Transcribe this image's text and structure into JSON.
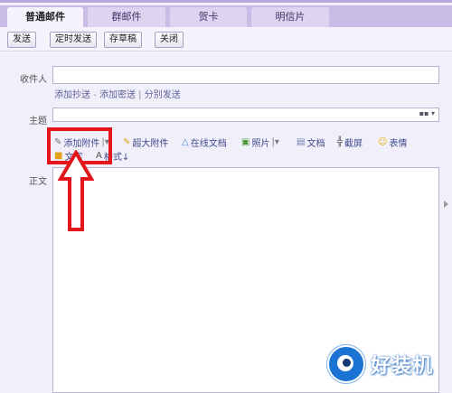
{
  "tabs": [
    "普通邮件",
    "群邮件",
    "贺卡",
    "明信片"
  ],
  "toolbar": {
    "send": "发送",
    "scheduled_send": "定时发送",
    "save_draft": "存草稿",
    "close": "关闭"
  },
  "recipient": {
    "label": "收件人",
    "value": ""
  },
  "recipient_links": {
    "add_cc": "添加抄送",
    "dash": " - ",
    "add_bcc": "添加密送",
    "bar": " | ",
    "separate_send": "分别发送"
  },
  "subject": {
    "label": "主题",
    "value": "",
    "selector": "▪▪ ▾"
  },
  "attach_tools": {
    "add_attachment": "添加附件",
    "dropdown": "|▾",
    "super_attachment": "超大附件",
    "online_doc": "在线文档",
    "photo": "照片",
    "photo_dropdown": "|▾",
    "document": "文档",
    "screenshot": "截屏",
    "emoji": "表情",
    "row2_a": "文字",
    "row2_b": "格式↓"
  },
  "body": {
    "label": "正文",
    "value": ""
  },
  "watermark_text": "好装机",
  "colors": {
    "highlight": "#e5161b",
    "accent": "#1b73d3"
  }
}
